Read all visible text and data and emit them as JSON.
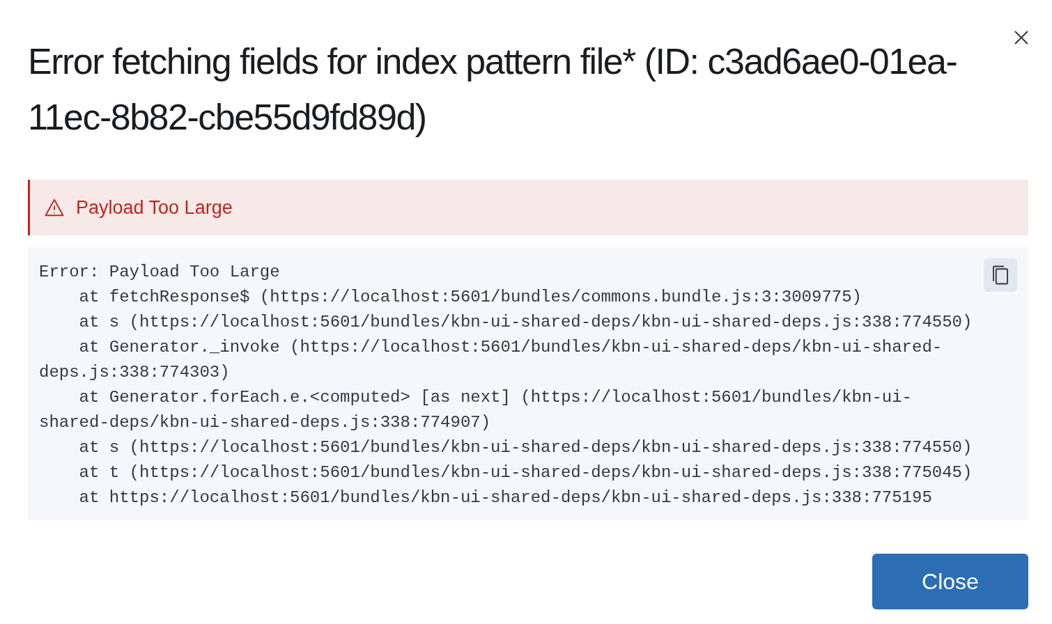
{
  "modal": {
    "title": "Error fetching fields for index pattern file* (ID: c3ad6ae0-01ea-11ec-8b82-cbe55d9fd89d)",
    "callout": {
      "text": "Payload Too Large"
    },
    "stack_trace": [
      "Error: Payload Too Large",
      "    at fetchResponse$ (https://localhost:5601/bundles/commons.bundle.js:3:3009775)",
      "    at s (https://localhost:5601/bundles/kbn-ui-shared-deps/kbn-ui-shared-deps.js:338:774550)",
      "    at Generator._invoke (https://localhost:5601/bundles/kbn-ui-shared-deps/kbn-ui-shared-deps.js:338:774303)",
      "    at Generator.forEach.e.<computed> [as next] (https://localhost:5601/bundles/kbn-ui-shared-deps/kbn-ui-shared-deps.js:338:774907)",
      "    at s (https://localhost:5601/bundles/kbn-ui-shared-deps/kbn-ui-shared-deps.js:338:774550)",
      "    at t (https://localhost:5601/bundles/kbn-ui-shared-deps/kbn-ui-shared-deps.js:338:775045)",
      "    at https://localhost:5601/bundles/kbn-ui-shared-deps/kbn-ui-shared-deps.js:338:775195"
    ],
    "buttons": [
      "Close"
    ]
  }
}
